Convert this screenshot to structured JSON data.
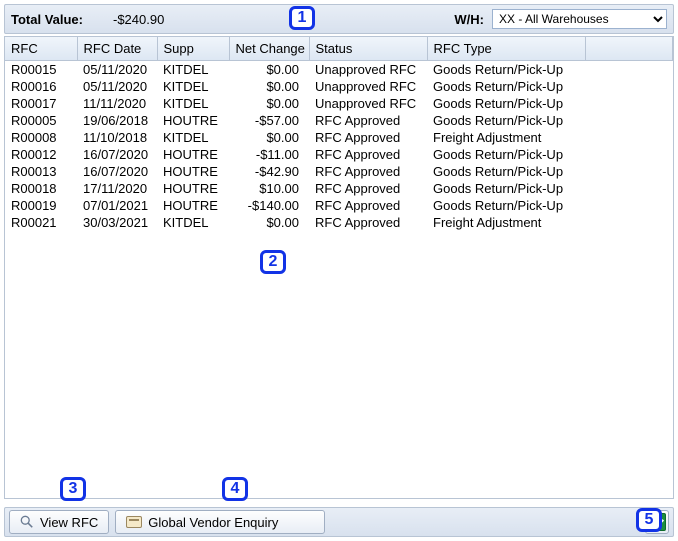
{
  "header": {
    "total_label": "Total Value:",
    "total_value": "-$240.90",
    "wh_label": "W/H:",
    "wh_selected": "XX - All Warehouses"
  },
  "columns": {
    "rfc": "RFC",
    "rfc_date": "RFC Date",
    "supp": "Supp",
    "net_change": "Net Change",
    "status": "Status",
    "rfc_type": "RFC Type"
  },
  "rows": [
    {
      "rfc": "R00015",
      "date": "05/11/2020",
      "supp": "KITDEL",
      "net": "$0.00",
      "status": "Unapproved RFC",
      "type": "Goods Return/Pick-Up"
    },
    {
      "rfc": "R00016",
      "date": "05/11/2020",
      "supp": "KITDEL",
      "net": "$0.00",
      "status": "Unapproved RFC",
      "type": "Goods Return/Pick-Up"
    },
    {
      "rfc": "R00017",
      "date": "11/11/2020",
      "supp": "KITDEL",
      "net": "$0.00",
      "status": "Unapproved RFC",
      "type": "Goods Return/Pick-Up"
    },
    {
      "rfc": "R00005",
      "date": "19/06/2018",
      "supp": "HOUTRE",
      "net": "-$57.00",
      "status": "RFC Approved",
      "type": "Goods Return/Pick-Up"
    },
    {
      "rfc": "R00008",
      "date": "11/10/2018",
      "supp": "KITDEL",
      "net": "$0.00",
      "status": "RFC Approved",
      "type": "Freight Adjustment"
    },
    {
      "rfc": "R00012",
      "date": "16/07/2020",
      "supp": "HOUTRE",
      "net": "-$11.00",
      "status": "RFC Approved",
      "type": "Goods Return/Pick-Up"
    },
    {
      "rfc": "R00013",
      "date": "16/07/2020",
      "supp": "HOUTRE",
      "net": "-$42.90",
      "status": "RFC Approved",
      "type": "Goods Return/Pick-Up"
    },
    {
      "rfc": "R00018",
      "date": "17/11/2020",
      "supp": "HOUTRE",
      "net": "$10.00",
      "status": "RFC Approved",
      "type": "Goods Return/Pick-Up"
    },
    {
      "rfc": "R00019",
      "date": "07/01/2021",
      "supp": "HOUTRE",
      "net": "-$140.00",
      "status": "RFC Approved",
      "type": "Goods Return/Pick-Up"
    },
    {
      "rfc": "R00021",
      "date": "30/03/2021",
      "supp": "KITDEL",
      "net": "$0.00",
      "status": "RFC Approved",
      "type": "Freight Adjustment"
    }
  ],
  "footer": {
    "view_rfc": "View RFC",
    "global_vendor": "Global Vendor Enquiry"
  },
  "callouts": {
    "c1": "1",
    "c2": "2",
    "c3": "3",
    "c4": "4",
    "c5": "5"
  }
}
